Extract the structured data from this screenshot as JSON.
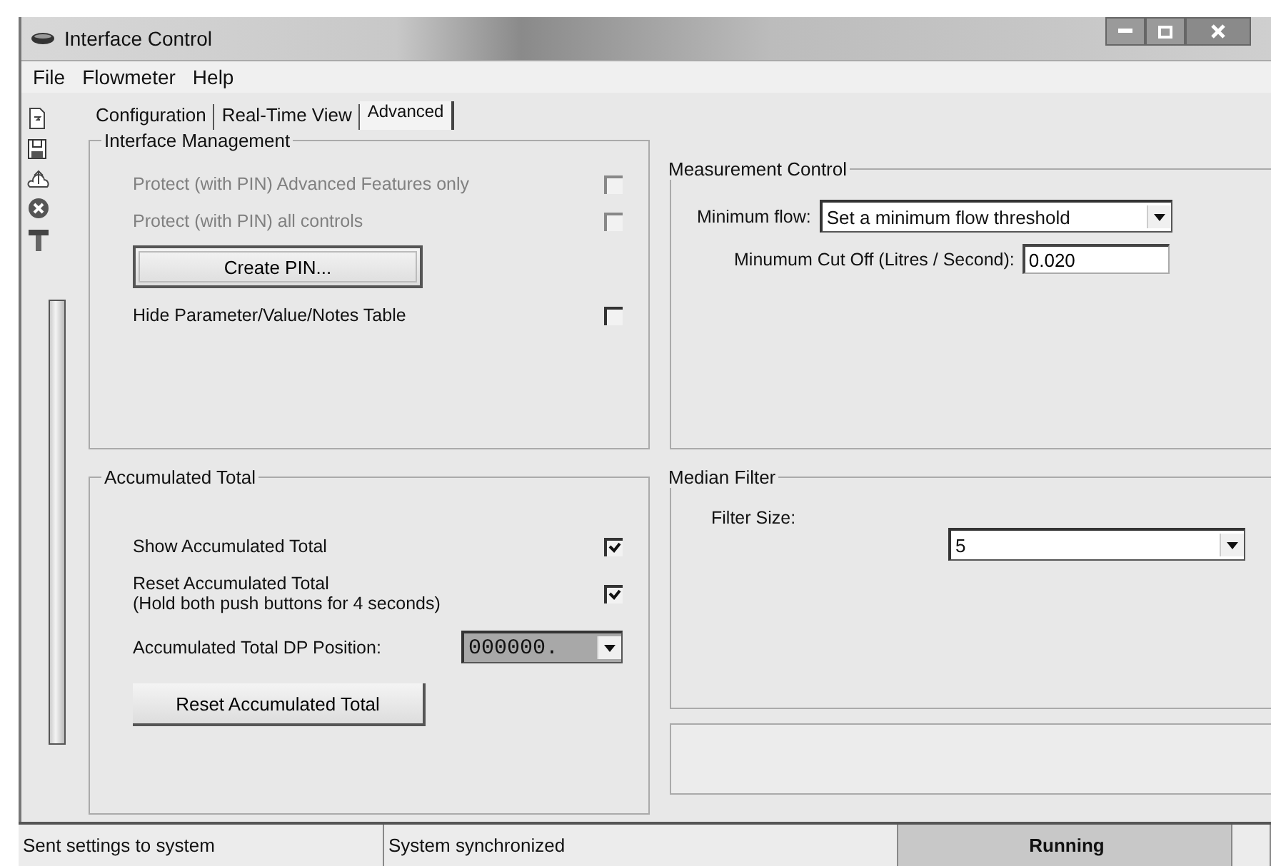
{
  "window": {
    "title": "Interface Control"
  },
  "menu": [
    {
      "label": "File"
    },
    {
      "label": "Flowmeter"
    },
    {
      "label": "Help"
    }
  ],
  "tabs": [
    {
      "label": "Configuration",
      "selected": false
    },
    {
      "label": "Real-Time View",
      "selected": false
    },
    {
      "label": "Advanced",
      "selected": true
    }
  ],
  "interface_management": {
    "title": "Interface Management",
    "items": [
      {
        "kind": "checkbox",
        "label": "Protect (with PIN) Advanced Features only",
        "checked": false,
        "disabled": true
      },
      {
        "kind": "checkbox",
        "label": "Protect (with PIN) all controls",
        "checked": false,
        "disabled": true
      },
      {
        "kind": "button",
        "label": "Create PIN..."
      },
      {
        "kind": "checkbox",
        "label": "Hide Parameter/Value/Notes Table",
        "checked": false,
        "disabled": false
      }
    ]
  },
  "accumulated_total": {
    "title": "Accumulated Total",
    "items": [
      {
        "kind": "checkbox",
        "label": "Show Accumulated Total",
        "checked": true,
        "disabled": false
      },
      {
        "kind": "checkbox",
        "label": "Reset Accumulated Total",
        "note": "(Hold both push buttons for 4 seconds)",
        "checked": true,
        "disabled": false
      },
      {
        "kind": "dropdown",
        "label": "Accumulated Total DP Position:",
        "value": "000000."
      },
      {
        "kind": "button",
        "label": "Reset Accumulated Total"
      }
    ]
  },
  "measurement_control": {
    "title": "Measurement Control",
    "minimum_flow": {
      "label": "Minimum flow:",
      "value": "Set a minimum flow threshold"
    },
    "cut_off": {
      "label": "Minumum Cut Off (Litres / Second):",
      "value": "0.020"
    }
  },
  "median_filter": {
    "title": "Median Filter",
    "filter_size": {
      "label": "Filter Size:",
      "value": "5"
    }
  },
  "status_bar": [
    {
      "text": "Sent settings to system",
      "kind": "plain"
    },
    {
      "text": "System synchronized",
      "kind": "plain"
    },
    {
      "text": "Running",
      "kind": "state"
    }
  ]
}
